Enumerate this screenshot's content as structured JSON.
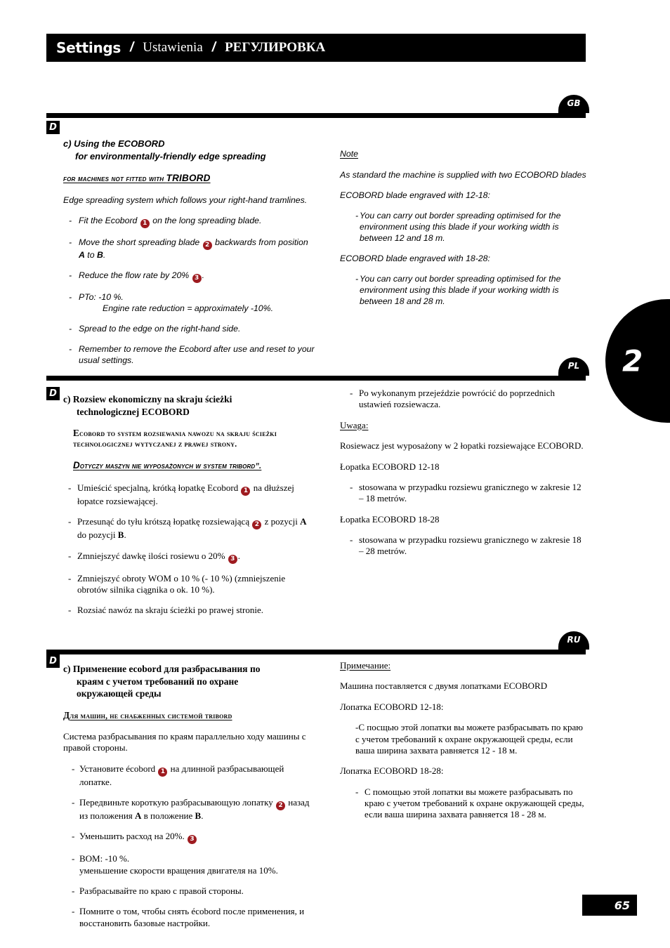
{
  "header": {
    "title_en": "Settings",
    "separator": "/",
    "title_pl": "Ustawienia",
    "title_ru": "РЕГУЛИРОВКА"
  },
  "chapter_tab": {
    "number": "2"
  },
  "page_number": "65",
  "badges": {
    "d": "D",
    "gb": "GB",
    "pl": "PL",
    "ru": "RU"
  },
  "gb": {
    "heading_line1": "c)  Using the ECOBORD",
    "heading_line2": "for environmentally-friendly edge spreading",
    "subheading_small": "For machines not fitted with ",
    "subheading_big": "TRIBORD",
    "intro": "Edge spreading system which follows your right-hand tramlines.",
    "bullets": [
      {
        "pre": "Fit the Ecobord ",
        "num": "1",
        "post": " on the long spreading blade."
      },
      {
        "pre": "Move the short spreading blade ",
        "num": "2",
        "post": " backwards from position A to B."
      },
      {
        "pre": "Reduce the flow rate by 20% ",
        "num": "3",
        "post": "."
      },
      {
        "pre": "PTo:  -10 %.",
        "indent": "Engine rate reduction = approximately -10%."
      },
      {
        "pre": "Spread to the edge on the right-hand side."
      },
      {
        "pre": "Remember to remove the Ecobord after use and reset to your usual settings."
      }
    ],
    "note_title": "Note",
    "note_intro": "As standard the machine is supplied with two ECOBORD blades",
    "blade1_title": "ECOBORD blade engraved with 12-18:",
    "blade1_text": "You can carry out border spreading optimised for the environment using this blade if your working width is between 12 and 18 m.",
    "blade2_title": "ECOBORD blade engraved with 18-28:",
    "blade2_text": "You can carry out border spreading optimised for the environment using this blade if your working width is between 18 and 28 m."
  },
  "pl": {
    "heading_line1": "c)  Rozsiew ekonomiczny na skraju ścieżki",
    "heading_line2": "technologicznej ECOBORD",
    "caps_big": "E",
    "caps_text": "cobord to system rozsiewania nawozu na skraju ścieżki technologicznej wytyczanej z prawej strony.",
    "italcaps_big": "D",
    "italcaps_text": "otyczy maszyn nie wyposażonych w system TRIBORD”.",
    "bullets": [
      {
        "pre": "Umieścić specjalną, krótką łopatkę Ecobord ",
        "num": "1",
        "post": " na dłuższej łopatce rozsiewającej."
      },
      {
        "pre": "Przesunąć do tyłu krótszą łopatkę rozsiewającą ",
        "num": "2",
        "post": " z pozycji A do pozycji B."
      },
      {
        "pre": "Zmniejszyć dawkę ilości rosiewu o 20% ",
        "num": "3",
        "post": "."
      },
      {
        "pre": "Zmniejszyć obroty WOM o 10 % (- 10 %) (zmniejszenie obrotów silnika ciągnika o ok. 10 %)."
      },
      {
        "pre": "Rozsiać nawóz na skraju ścieżki po prawej stronie."
      }
    ],
    "right_bullet": "Po wykonanym przejeździe powrócić do poprzednich ustawień rozsiewacza.",
    "note_title": "Uwaga:",
    "note_intro": "Rosiewacz jest wyposażony w 2 łopatki rozsiewające ECOBORD.",
    "blade1_title": "Łopatka ECOBORD 12-18",
    "blade1_text": "stosowana w przypadku rozsiewu granicznego w zakresie 12 – 18 metrów.",
    "blade2_title": "Łopatka ECOBORD 18-28",
    "blade2_text": "stosowana w przypadku rozsiewu granicznego w zakresie 18 – 28 metrów."
  },
  "ru": {
    "heading_line1": "c) Применение ecobord для разбрасывания по",
    "heading_line2": "краям с учетом требований по охране",
    "heading_line3": "окружающей среды",
    "caps_big": "Д",
    "caps_text": "ля машин, не снабженных системой TRIBORD",
    "intro": "Система разбрасывания по краям параллельно ходу машины с правой стороны.",
    "bullets": [
      {
        "pre": "Установите écobord ",
        "num": "1",
        "post": " на длинной разбрасывающей лопатке."
      },
      {
        "pre": "Передвиньте короткую разбрасывающую лопатку ",
        "num": "2",
        "post": " назад из положения A в положение B."
      },
      {
        "pre": "Уменьшить расход на 20%. ",
        "num": "3",
        "post": ""
      },
      {
        "pre": "ВОМ: -10 %.",
        "indent": "уменьшение скорости вращения двигателя на 10%."
      },
      {
        "pre": "Разбрасывайте по краю с правой стороны."
      },
      {
        "pre": "Помните о том, чтобы снять écobord после применения, и восстановить базовые настройки."
      }
    ],
    "note_title": "Примечание:",
    "note_intro": "Машина поставляется с двумя лопатками ECOBORD",
    "blade1_title": "Лопатка ECOBORD 12-18:",
    "blade1_text": "-С посщью этой лопатки вы можете разбрасывать по краю с учетом требований к охране окружающей среды, если ваша ширина захвата равняется 12 - 18 м.",
    "blade2_title": "Лопатка ECOBORD 18-28:",
    "blade2_text": "С помощью этой лопатки вы можете разбрасывать по краю с учетом требований к охране окружающей среды, если ваша ширина захвата равняется 18 - 28 м."
  }
}
